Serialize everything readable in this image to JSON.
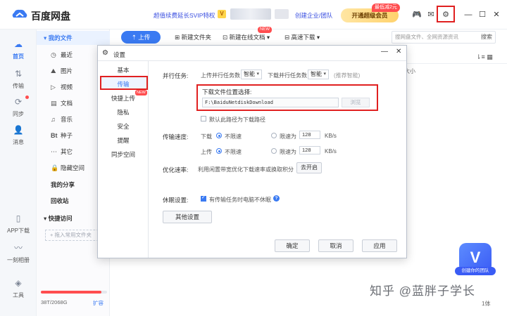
{
  "app": {
    "title": "百度网盘"
  },
  "topbar": {
    "promo": "超值续费延长SVIP特权",
    "vip_tag": "V",
    "enterprise": "创建企业/团队",
    "super_member": "开通超级会员",
    "discount": "最低减2元",
    "icons": [
      "game-icon",
      "mail-icon",
      "gear-icon",
      "minimize-icon",
      "maximize-icon",
      "close-icon"
    ]
  },
  "rail": {
    "items": [
      {
        "label": "首页",
        "icon": "cloud-icon"
      },
      {
        "label": "传输",
        "icon": "transfer-icon"
      },
      {
        "label": "同步",
        "icon": "sync-icon"
      },
      {
        "label": "消息",
        "icon": "user-icon"
      },
      {
        "label": "APP下载",
        "icon": "phone-icon"
      },
      {
        "label": "一刻相册",
        "icon": "album-icon"
      },
      {
        "label": "工具",
        "icon": "tools-icon"
      }
    ]
  },
  "sidebar": {
    "my_files": "我的文件",
    "items": [
      {
        "label": "最近",
        "icon": "clock-icon"
      },
      {
        "label": "图片",
        "icon": "image-icon"
      },
      {
        "label": "视频",
        "icon": "play-icon"
      },
      {
        "label": "文档",
        "icon": "doc-icon"
      },
      {
        "label": "音乐",
        "icon": "music-icon"
      },
      {
        "label": "种子",
        "icon": "bt-icon"
      },
      {
        "label": "其它",
        "icon": "more-icon"
      },
      {
        "label": "隐藏空间",
        "icon": "lock-icon"
      }
    ],
    "my_share": "我的分享",
    "recycle": "回收站",
    "quick_access": "快捷访问",
    "drop_hint": "+ 拖入常用文件夹",
    "storage": "38T/2068G",
    "storage_used_fraction": 0.92,
    "expand": "扩容"
  },
  "toolbar": {
    "upload": "上传",
    "new_folder": "新建文件夹",
    "new_online_doc": "新建在线文档",
    "new_badge": "NEW",
    "advanced_download": "高速下载",
    "search_placeholder": "搜网盘文件、全网资源资讯",
    "search_btn": "搜索",
    "size_col": "大小",
    "view_icons": "⇂≡  ▦"
  },
  "dialog": {
    "title": "设置",
    "nav": [
      {
        "label": "基本"
      },
      {
        "label": "传输",
        "active": true
      },
      {
        "label": "快捷上传",
        "badge": "NEW"
      },
      {
        "label": "隐私"
      },
      {
        "label": "安全"
      },
      {
        "label": "提醒"
      },
      {
        "label": "同步空间"
      }
    ],
    "parallel_label": "并行任务:",
    "upload_parallel": "上传并行任务数",
    "upload_parallel_value": "智能",
    "download_parallel": "下载并行任务数",
    "download_parallel_value": "智能",
    "recommend": "(推荐智能)",
    "download_location_title": "下载文件位置选择:",
    "download_path": "F:\\BaiduNetdiskDownload",
    "browse": "浏览",
    "default_path": "默认此路径为下载路径",
    "speed_label": "传输速度:",
    "download": "下载",
    "upload": "上传",
    "unlimited": "不限速",
    "limit_to": "限速为",
    "download_limit": "128",
    "upload_limit": "128",
    "unit": "KB/s",
    "optimize_label": "优化速率:",
    "optimize_text": "利用闲置带宽优化下载速率或换取积分",
    "optimize_btn": "去开启",
    "sleep_label": "休眠设置:",
    "sleep_text": "有传输任务时电脑不休眠",
    "other_settings": "其他设置",
    "ok": "确定",
    "cancel": "取消",
    "apply": "应用"
  },
  "assistant": {
    "letter": "V",
    "label": "创建你的团队"
  },
  "watermark": {
    "text": "知乎 @蓝胖子学长",
    "num": "1体"
  }
}
